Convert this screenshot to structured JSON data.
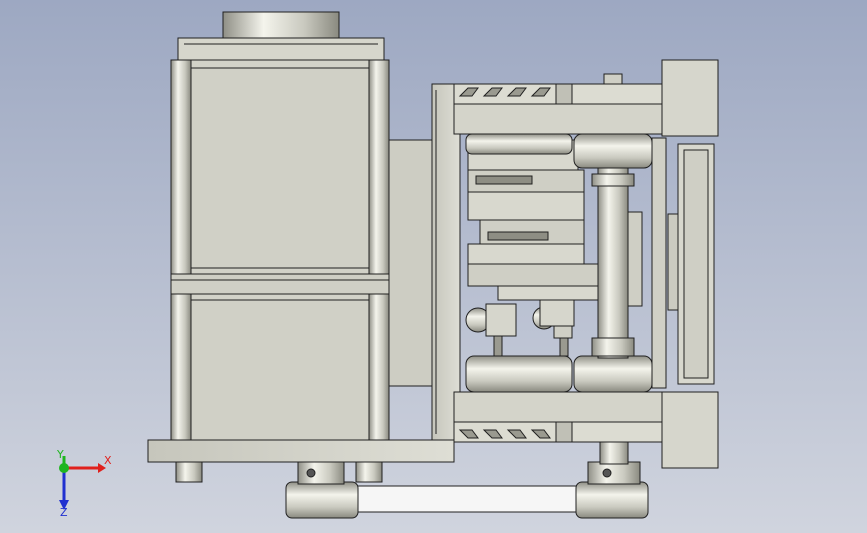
{
  "viewport": {
    "background_top": "#9da8c2",
    "background_bottom": "#d0d4de"
  },
  "model": {
    "part_fill": "#d9d9cf",
    "part_shade": "#a9a99f",
    "part_highlight": "#f2f2ea",
    "edge": "#202020",
    "belt": "#f6f6f6"
  },
  "triad": {
    "x_label": "X",
    "y_label": "Y",
    "z_label": "Z",
    "x_color": "#e0201c",
    "y_color": "#1fb51f",
    "z_color": "#2030d0"
  }
}
